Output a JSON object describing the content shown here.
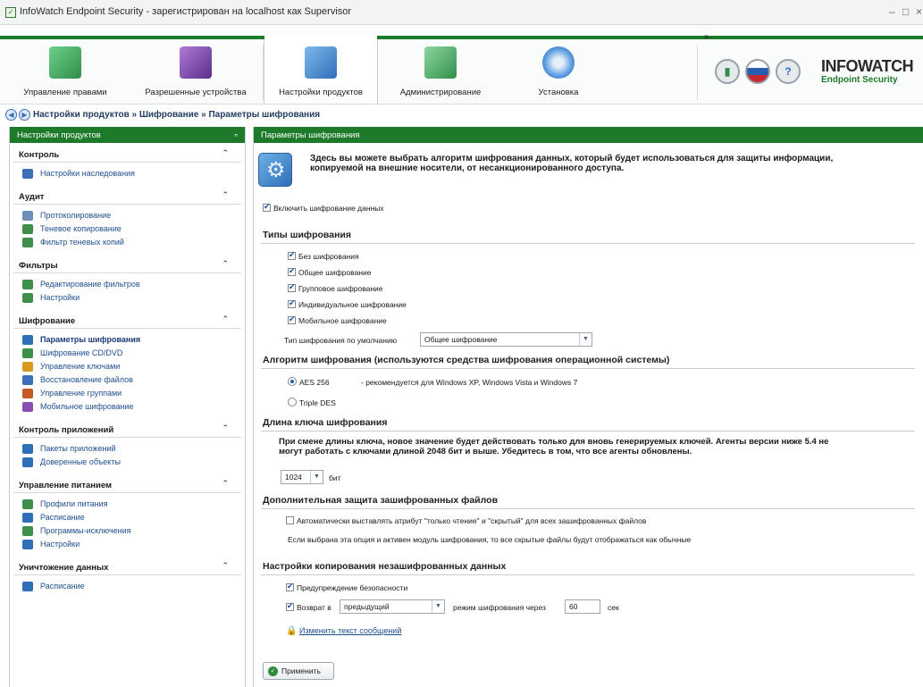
{
  "window": {
    "title": "InfoWatch Endpoint Security - зарегистрирован на localhost как Supervisor",
    "minimize": "–",
    "maximize": "□",
    "close": "×"
  },
  "ribbon": {
    "tabs": [
      {
        "label": "Управление правами",
        "icon": "users-rights-icon",
        "color": "#2f8f4a"
      },
      {
        "label": "Разрешенные устройства",
        "icon": "usb-device-icon",
        "color": "#6a3c9a"
      },
      {
        "label": "Настройки продуктов",
        "icon": "product-settings-icon",
        "color": "#2e6fb8",
        "active": true
      },
      {
        "label": "Администрирование",
        "icon": "administration-icon",
        "color": "#2f8f4a"
      },
      {
        "label": "Установка",
        "icon": "install-disc-icon",
        "color": "#2e6fb8"
      }
    ],
    "more": "»",
    "logo_main": "INFOWATCH",
    "logo_sub": "Endpoint Security"
  },
  "breadcrumb": "Настройки продуктов » Шифрование » Параметры шифрования",
  "sidebar": {
    "title": "Настройки продуктов",
    "pin": "ₙ",
    "sections": [
      {
        "title": "Контроль",
        "items": [
          {
            "label": "Настройки наследования",
            "color": "#3c6fb6"
          }
        ]
      },
      {
        "title": "Аудит",
        "items": [
          {
            "label": "Протоколирование",
            "color": "#6d8fb9"
          },
          {
            "label": "Теневое копирование",
            "color": "#3f8f4a"
          },
          {
            "label": "Фильтр теневых копий",
            "color": "#3f8f4a"
          }
        ]
      },
      {
        "title": "Фильтры",
        "items": [
          {
            "label": "Редактирование фильтров",
            "color": "#3f8f4a"
          },
          {
            "label": "Настройки",
            "color": "#3f8f4a"
          }
        ]
      },
      {
        "title": "Шифрование",
        "items": [
          {
            "label": "Параметры шифрования",
            "color": "#2e6fb8",
            "active": true
          },
          {
            "label": "Шифрование CD/DVD",
            "color": "#3f8f4a"
          },
          {
            "label": "Управление ключами",
            "color": "#d59a1e"
          },
          {
            "label": "Восстановление файлов",
            "color": "#3c6fb6"
          },
          {
            "label": "Управление группами",
            "color": "#c45a2a"
          },
          {
            "label": "Мобильное шифрование",
            "color": "#8a4fb0"
          }
        ]
      },
      {
        "title": "Контроль приложений",
        "items": [
          {
            "label": "Пакеты приложений",
            "color": "#2e6fb8"
          },
          {
            "label": "Доверенные объекты",
            "color": "#2e6fb8"
          }
        ]
      },
      {
        "title": "Управление питанием",
        "items": [
          {
            "label": "Профили питания",
            "color": "#3f8f4a"
          },
          {
            "label": "Расписание",
            "color": "#2e6fb8"
          },
          {
            "label": "Программы-исключения",
            "color": "#3f8f4a"
          },
          {
            "label": "Настройки",
            "color": "#2e6fb8"
          }
        ]
      },
      {
        "title": "Уничтожение данных",
        "items": [
          {
            "label": "Расписание",
            "color": "#2e6fb8"
          }
        ]
      }
    ]
  },
  "content": {
    "title": "Параметры шифрования",
    "intro_line1": "Здесь вы можете выбрать алгоритм шифрования данных, который будет использоваться для защиты информации,",
    "intro_line2": "копируемой на внешние носители, от несанкционированного доступа.",
    "enable_label": "Включить шифрование данных",
    "types_header": "Типы шифрования",
    "types": [
      "Без шифрования",
      "Общее шифрование",
      "Групповое шифрование",
      "Индивидуальное шифрование",
      "Мобильное шифрование"
    ],
    "default_type_label": "Тип шифрования по умолчанию",
    "default_type_value": "Общее шифрование",
    "algo_header": "Алгоритм шифрования (используются средства шифрования операционной системы)",
    "algo_aes": "AES 256",
    "algo_aes_note": "- рекомендуется для Windows XP, Windows Vista и Windows 7",
    "algo_3des": "Triple DES",
    "key_header": "Длина ключа шифрования",
    "key_note1": "При смене длины ключа, новое значение будет действовать только для вновь генерируемых ключей. Агенты версии ниже 5.4 не",
    "key_note2": "могут работать с ключами длиной 2048 бит и выше. Убедитесь в том, что все агенты обновлены.",
    "key_value": "1024",
    "key_unit": "бит",
    "extra_header": "Дополнительная защита зашифрованных файлов",
    "extra_cb": "Автоматически выставлять атрибут \"только чтение\" и \"скрытый\" для всех зашифрованных файлов",
    "extra_note": "Если выбрана эта опция и активен модуль шифрования, то все скрытые файлы будут отображаться как обычные",
    "copy_header": "Настройки копирования незашифрованных данных",
    "warn_cb": "Предупреждение безопасности",
    "return_cb": "Возврат в",
    "return_mode": "предыдущий",
    "return_after": "режим шифрования через",
    "return_seconds": "60",
    "return_unit": "сек",
    "change_msg_link": "Изменить текст сообщений",
    "apply_label": "Применить"
  }
}
